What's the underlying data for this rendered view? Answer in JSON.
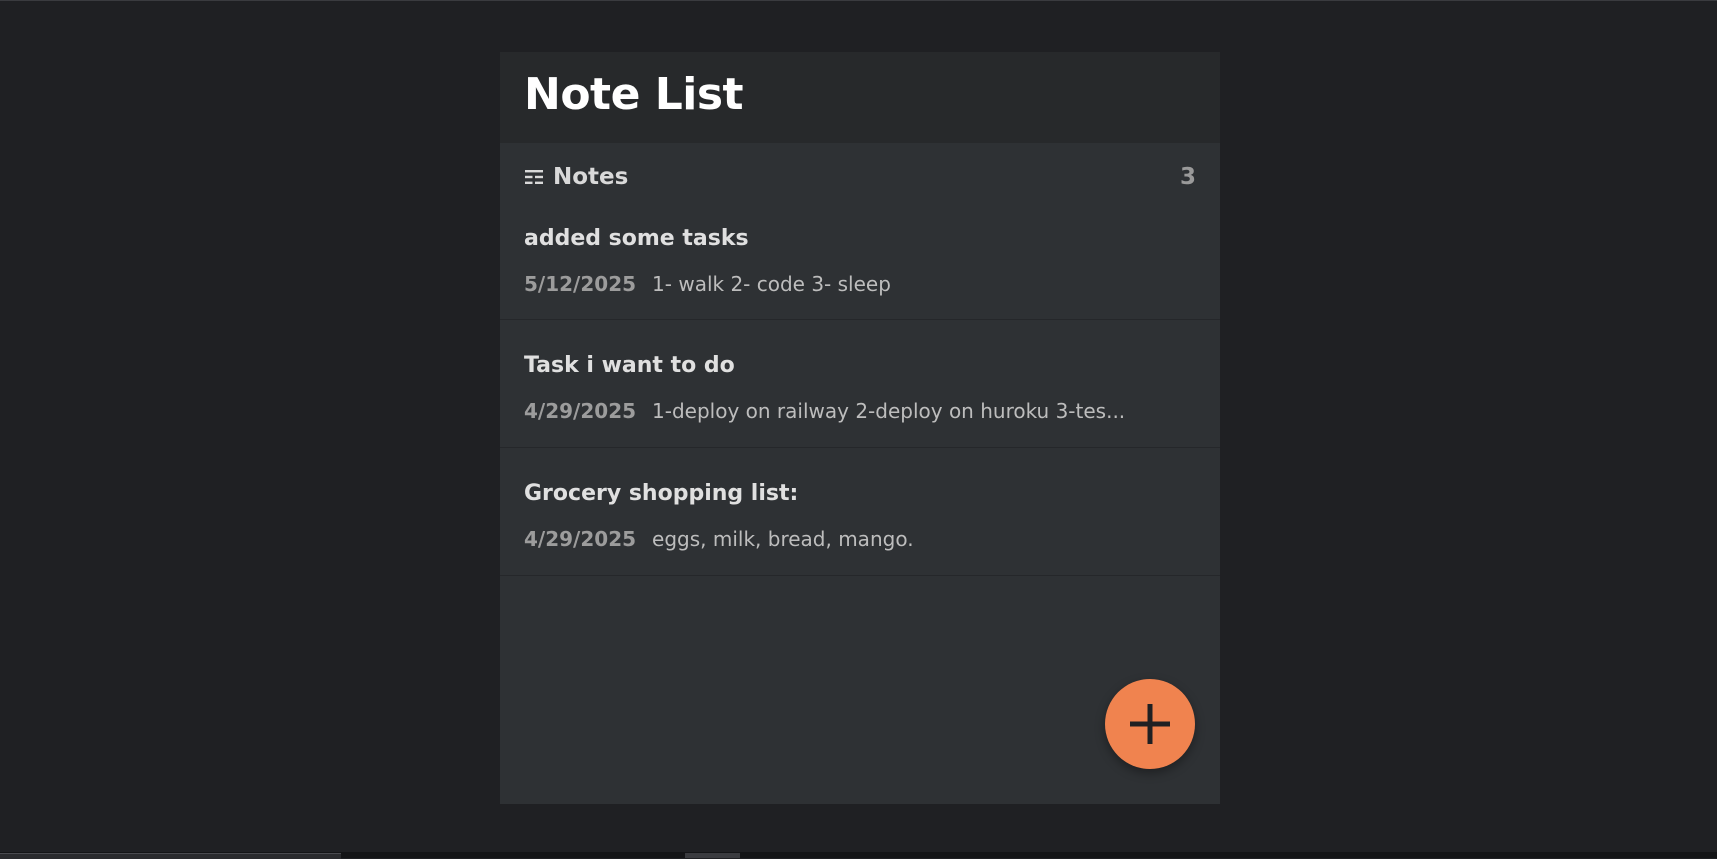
{
  "app": {
    "title": "Note List"
  },
  "notes_section": {
    "label": "Notes",
    "count": "3",
    "icon": "list-icon"
  },
  "notes": [
    {
      "title": "added some tasks",
      "date": "5/12/2025",
      "preview": "1- walk 2- code 3- sleep"
    },
    {
      "title": "Task i want to do",
      "date": "4/29/2025",
      "preview": "1-deploy on railway 2-deploy on huroku 3-tes..."
    },
    {
      "title": "Grocery shopping list:",
      "date": "4/29/2025",
      "preview": "eggs, milk, bread, mango."
    }
  ],
  "fab": {
    "icon": "plus-icon",
    "color": "#f0834f"
  },
  "colors": {
    "background": "#1f2023",
    "panel": "#2e3134",
    "header": "#27292b",
    "accent": "#f0834f"
  }
}
